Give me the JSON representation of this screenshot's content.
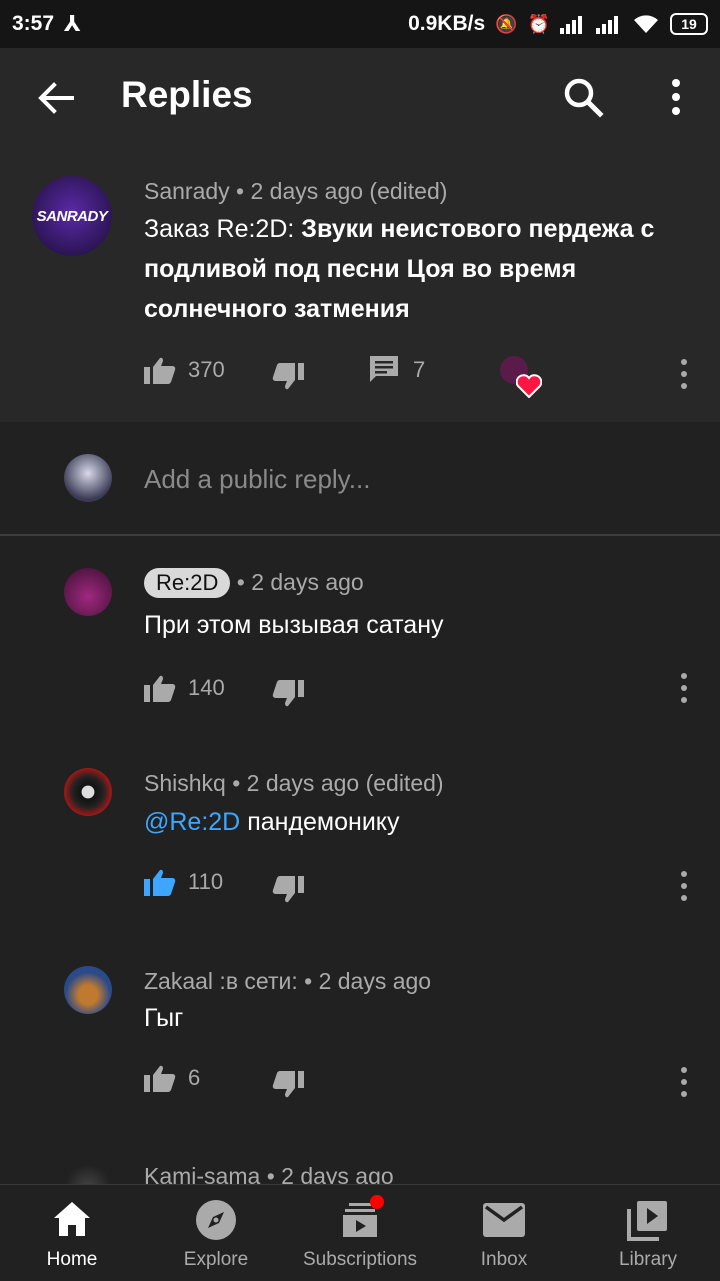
{
  "status": {
    "time": "3:57",
    "speed": "0.9KB/s",
    "battery": "19"
  },
  "appbar": {
    "title": "Replies"
  },
  "original_comment": {
    "author": "Sanrady",
    "meta_rest": " • 2 days ago (edited)",
    "text_plain": "Заказ Re:2D: ",
    "text_bold": "Звуки неистового пердежа с подливой под песни Цоя во время солнечного затмения",
    "likes": "370",
    "replies": "7",
    "avatar_text": "SANRADY"
  },
  "reply_input": {
    "placeholder": "Add a public reply..."
  },
  "comments": [
    {
      "author": "Re:2D",
      "time": " • 2 days ago",
      "text": "При этом вызывая сатану",
      "likes": "140"
    },
    {
      "author": "Shishkq",
      "time": " • 2 days ago (edited)",
      "mention": "@Re:2D",
      "text": " пандемонику",
      "likes": "110"
    },
    {
      "author": "Zakaal :в сети:",
      "time": " • 2 days ago",
      "text": "Гыг",
      "likes": "6"
    },
    {
      "author": "Kami-sama",
      "time": " • 2 days ago"
    }
  ],
  "nav": {
    "home": "Home",
    "explore": "Explore",
    "subscriptions": "Subscriptions",
    "inbox": "Inbox",
    "library": "Library"
  },
  "colors": {
    "accent_blue": "#3ea6ff",
    "heart_red": "#ff1744",
    "background": "#212121"
  }
}
